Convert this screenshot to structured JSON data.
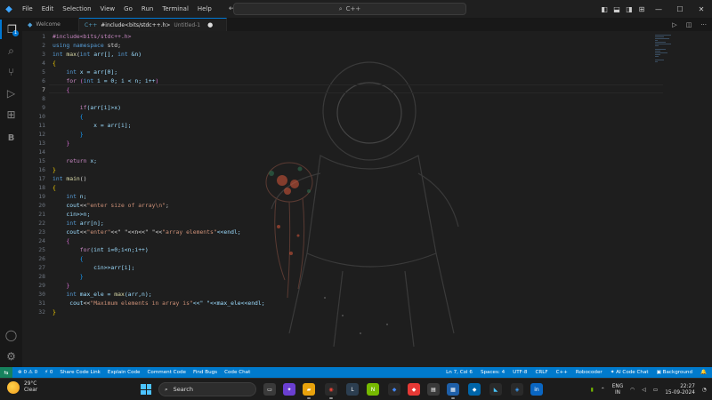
{
  "titlebar": {
    "menu": [
      "File",
      "Edit",
      "Selection",
      "View",
      "Go",
      "Run",
      "Terminal",
      "Help"
    ],
    "command_center": "C++"
  },
  "tabs": [
    {
      "label": "Welcome",
      "active": false
    },
    {
      "label": "#include<bits/stdc++.h>",
      "sub": "Untitled-1",
      "active": true,
      "dirty": "●"
    }
  ],
  "editor": {
    "current_line": 7,
    "lines": [
      [
        [
          "#include<bits/stdc++.h>",
          "#c586c0"
        ]
      ],
      [
        [
          "using namespace ",
          "#569cd6"
        ],
        [
          "std;",
          "#d4d4d4"
        ]
      ],
      [
        [
          "int ",
          "#569cd6"
        ],
        [
          "max",
          "#dcdcaa"
        ],
        [
          "(",
          "#d4d4d4"
        ],
        [
          "int ",
          "#569cd6"
        ],
        [
          "arr[], ",
          "#9cdcfe"
        ],
        [
          "int ",
          "#569cd6"
        ],
        [
          "&n)",
          "#9cdcfe"
        ]
      ],
      [
        [
          "{",
          "#ffd700"
        ]
      ],
      [
        [
          "    int ",
          "#569cd6"
        ],
        [
          "x = arr[0];",
          "#9cdcfe"
        ]
      ],
      [
        [
          "    for ",
          "#c586c0"
        ],
        [
          "(",
          "#da70d6"
        ],
        [
          "int ",
          "#569cd6"
        ],
        [
          "i = 0; i < n; i++",
          "#9cdcfe"
        ],
        [
          ")",
          "#da70d6"
        ]
      ],
      [
        [
          "    {",
          "#da70d6"
        ]
      ],
      [
        [
          "",
          ""
        ]
      ],
      [
        [
          "        if",
          "#c586c0"
        ],
        [
          "(arr[i]>x)",
          "#9cdcfe"
        ]
      ],
      [
        [
          "        {",
          "#179fff"
        ]
      ],
      [
        [
          "            x = arr[i];",
          "#9cdcfe"
        ]
      ],
      [
        [
          "        }",
          "#179fff"
        ]
      ],
      [
        [
          "    }",
          "#da70d6"
        ]
      ],
      [
        [
          "",
          ""
        ]
      ],
      [
        [
          "    return ",
          "#c586c0"
        ],
        [
          "x;",
          "#9cdcfe"
        ]
      ],
      [
        [
          "}",
          "#ffd700"
        ]
      ],
      [
        [
          "int ",
          "#569cd6"
        ],
        [
          "main",
          "#dcdcaa"
        ],
        [
          "()",
          "#d4d4d4"
        ]
      ],
      [
        [
          "{",
          "#ffd700"
        ]
      ],
      [
        [
          "    int ",
          "#569cd6"
        ],
        [
          "n;",
          "#9cdcfe"
        ]
      ],
      [
        [
          "    cout",
          "#9cdcfe"
        ],
        [
          "<<",
          "#d4d4d4"
        ],
        [
          "\"enter size of array\\n\"",
          "#ce9178"
        ],
        [
          ";",
          "#d4d4d4"
        ]
      ],
      [
        [
          "    cin>>n;",
          "#9cdcfe"
        ]
      ],
      [
        [
          "    int ",
          "#569cd6"
        ],
        [
          "arr[n];",
          "#9cdcfe"
        ]
      ],
      [
        [
          "    cout",
          "#9cdcfe"
        ],
        [
          "<<",
          "#d4d4d4"
        ],
        [
          "\"enter\"",
          "#ce9178"
        ],
        [
          "<<\" \"<<n<<\" \"<<",
          "#d4d4d4"
        ],
        [
          "\"array elements\"",
          "#ce9178"
        ],
        [
          "<<endl;",
          "#9cdcfe"
        ]
      ],
      [
        [
          "    {",
          "#da70d6"
        ]
      ],
      [
        [
          "        for",
          "#c586c0"
        ],
        [
          "(int i=0;i<n;i++)",
          "#9cdcfe"
        ]
      ],
      [
        [
          "        {",
          "#179fff"
        ]
      ],
      [
        [
          "            cin>>arr[i];",
          "#9cdcfe"
        ]
      ],
      [
        [
          "        }",
          "#179fff"
        ]
      ],
      [
        [
          "    }",
          "#da70d6"
        ]
      ],
      [
        [
          "    int ",
          "#569cd6"
        ],
        [
          "max_ele = ",
          "#9cdcfe"
        ],
        [
          "max",
          "#dcdcaa"
        ],
        [
          "(arr,n);",
          "#9cdcfe"
        ]
      ],
      [
        [
          "     cout",
          "#9cdcfe"
        ],
        [
          "<<",
          "#d4d4d4"
        ],
        [
          "\"Maximum elements in array is\"",
          "#ce9178"
        ],
        [
          "<<\" \"<<max_ele<<endl;",
          "#9cdcfe"
        ]
      ],
      [
        [
          "}",
          "#ffd700"
        ]
      ]
    ]
  },
  "statusbar": {
    "left": [
      "⊗ 0 ⚠ 0",
      "⚡ 0",
      "Share Code Link",
      "Explain Code",
      "Comment Code",
      "Find Bugs",
      "Code Chat"
    ],
    "right": [
      "Ln 7, Col 6",
      "Spaces: 4",
      "UTF-8",
      "CRLF",
      "C++",
      "Robocoder",
      "✦ AI Code Chat",
      "▣ Background",
      "🔔"
    ]
  },
  "taskbar": {
    "weather_temp": "29°C",
    "weather_desc": "Clear",
    "search_label": "Search",
    "lang": "ENG",
    "region": "IN",
    "time": "22:27",
    "date": "15-09-2024"
  }
}
